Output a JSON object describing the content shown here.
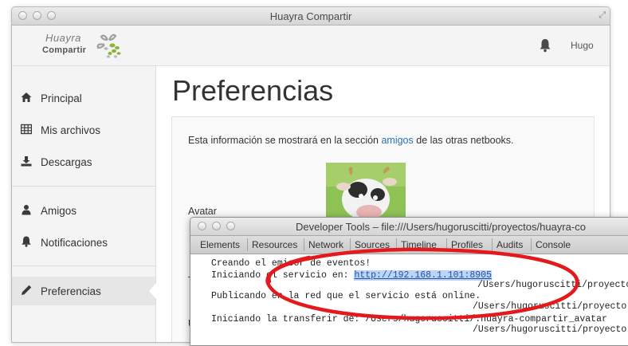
{
  "app": {
    "title": "Huayra Compartir",
    "logo_line1": "Huayra",
    "logo_line2": "Compartir"
  },
  "header": {
    "user_name": "Hugo"
  },
  "sidebar": {
    "items": [
      {
        "label": "Principal",
        "icon": "home-icon"
      },
      {
        "label": "Mis archivos",
        "icon": "grid-icon"
      },
      {
        "label": "Descargas",
        "icon": "download-icon"
      },
      {
        "label": "Amigos",
        "icon": "user-icon"
      },
      {
        "label": "Notificaciones",
        "icon": "bell-icon"
      },
      {
        "label": "Preferencias",
        "icon": "pencil-icon"
      }
    ],
    "active": "Preferencias"
  },
  "main": {
    "page_title": "Preferencias",
    "info_prefix": "Esta información se mostrará en la sección ",
    "info_link": "amigos",
    "info_suffix": " de las otras netbooks.",
    "avatar_label": "Avatar",
    "label_t": "T",
    "label_u": "U"
  },
  "devtools": {
    "title": "Developer Tools – file:///Users/hugoruscitti/proyectos/huayra-co",
    "tabs": [
      "Elements",
      "Resources",
      "Network",
      "Sources",
      "Timeline",
      "Profiles",
      "Audits",
      "Console"
    ],
    "active_tab": "Console",
    "console": {
      "line1": "Creando el emisor de eventos!",
      "line2_prefix": "Iniciando el servicio en: ",
      "line2_url": "http://192.168.1.101:8905",
      "line3": "/Users/hugoruscitti/proyecto",
      "line4": "Publicando en la red que el servicio está online.",
      "line5": "/Users/hugoruscitti/proyecto",
      "line6": "Iniciando la transferir de: /Users/hugoruscitti/.huayra-compartir_avatar",
      "line7": "/Users/hugoruscitti/proyecto"
    }
  },
  "colors": {
    "link": "#2a6fb6",
    "annotation": "#e3191b",
    "url_highlight": "#bcd4f5"
  }
}
